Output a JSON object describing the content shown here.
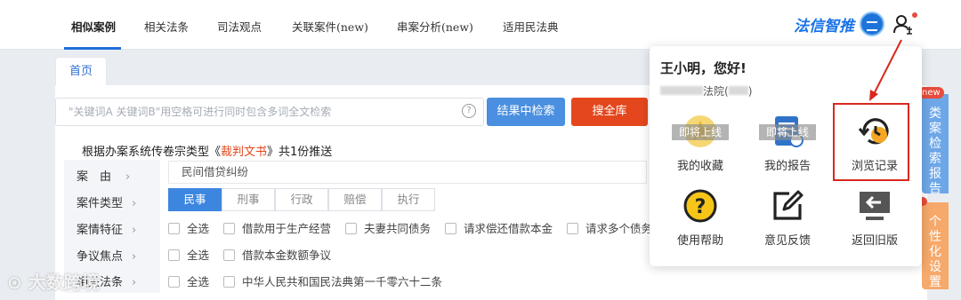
{
  "nav": {
    "tabs": [
      "相似案例",
      "相关法条",
      "司法观点",
      "关联案件(new)",
      "串案分析(new)",
      "适用民法典"
    ],
    "brand": "法信智推"
  },
  "home_tab": "首页",
  "search": {
    "placeholder": "\"关键词A 关键词B\"用空格可进行同时包含多词全文检索",
    "help_glyph": "?",
    "search_in_label": "结果中检索",
    "search_all_label": "搜全库"
  },
  "push": {
    "prefix": "根据办案系统传卷宗类型《",
    "doc": "裁判文书",
    "suffix": "》共1份推送"
  },
  "filters": {
    "labels": [
      "案　由",
      "案件类型",
      "案情特征",
      "争议焦点",
      "相关法条"
    ],
    "reason_value": "民间借贷纠纷",
    "case_types": [
      "民事",
      "刑事",
      "行政",
      "赔偿",
      "执行"
    ],
    "features": [
      "全选",
      "借款用于生产经营",
      "夫妻共同债务",
      "请求偿还借款本金",
      "请求多个债务人共"
    ],
    "disputes": [
      "全选",
      "借款本金数额争议"
    ],
    "laws": [
      "全选",
      "中华人民共和国民法典第一千零六十二条"
    ],
    "chevron": "›"
  },
  "popup": {
    "greeting": "王小明，您好!",
    "court_suffix": "法院(",
    "court_close": ")",
    "items": [
      {
        "label": "我的收藏",
        "badge": "即将上线",
        "icon": "star-icon"
      },
      {
        "label": "我的报告",
        "badge": "即将上线",
        "icon": "report-icon"
      },
      {
        "label": "浏览记录",
        "badge": "",
        "icon": "history-clock-icon"
      },
      {
        "label": "使用帮助",
        "badge": "",
        "icon": "help-icon"
      },
      {
        "label": "意见反馈",
        "badge": "",
        "icon": "edit-icon"
      },
      {
        "label": "返回旧版",
        "badge": "",
        "icon": "back-icon"
      }
    ]
  },
  "side": {
    "report_new": "new",
    "report_label": "类案检索报告",
    "personal_label": "个性化设置"
  },
  "watermark": "大数跨境",
  "colors": {
    "primary": "#3d86e0",
    "danger": "#e4471d",
    "highlight": "#d9281f"
  }
}
